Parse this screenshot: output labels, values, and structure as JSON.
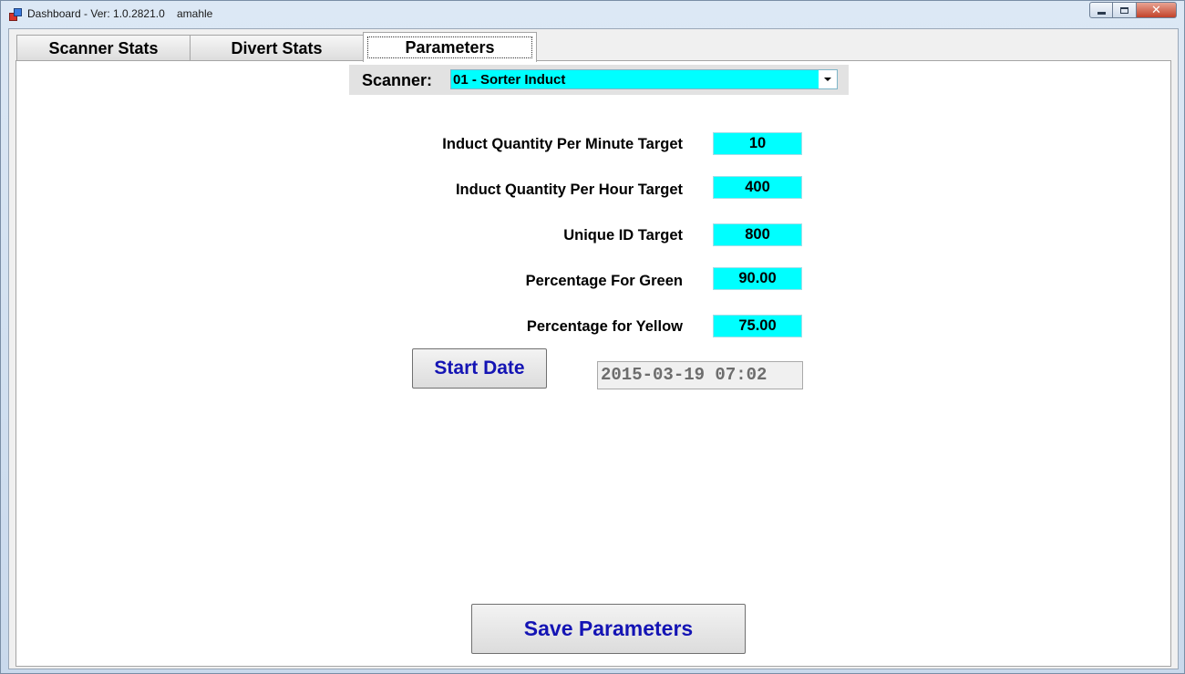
{
  "window": {
    "title": "Dashboard - Ver: 1.0.2821.0",
    "user": "amahle",
    "app_icon": "app-window-icon",
    "controls": {
      "minimize_icon": "minimize-icon",
      "maximize_icon": "maximize-icon",
      "close_icon": "close-icon",
      "close_glyph": "✕"
    }
  },
  "tabs": [
    {
      "label": "Scanner Stats",
      "active": false
    },
    {
      "label": "Divert Stats",
      "active": false
    },
    {
      "label": "Parameters",
      "active": true
    }
  ],
  "scanner": {
    "label": "Scanner:",
    "selected": "01 - Sorter Induct",
    "dropdown_icon": "chevron-down-icon"
  },
  "parameters": [
    {
      "label": "Induct Quantity Per Minute Target",
      "value": "10"
    },
    {
      "label": "Induct Quantity Per Hour Target",
      "value": "400"
    },
    {
      "label": "Unique ID Target",
      "value": "800"
    },
    {
      "label": "Percentage For Green",
      "value": "90.00"
    },
    {
      "label": "Percentage for Yellow",
      "value": "75.00"
    }
  ],
  "start_date": {
    "button_label": "Start Date",
    "value": "2015-03-19 07:02"
  },
  "save_button_label": "Save Parameters",
  "colors": {
    "input_background": "#00ffff",
    "button_text": "#1414b4"
  }
}
